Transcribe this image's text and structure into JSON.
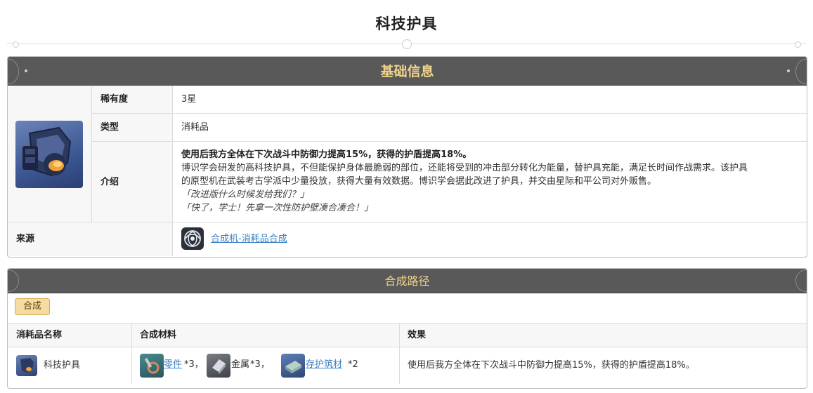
{
  "page": {
    "title": "科技护具"
  },
  "basic_info": {
    "header": "基础信息",
    "rows": {
      "rarity": {
        "label": "稀有度",
        "value": "3星"
      },
      "type": {
        "label": "类型",
        "value": "消耗品"
      },
      "intro": {
        "label": "介绍",
        "bold_line": "使用后我方全体在下次战斗中防御力提高15%，获得的护盾提高18%。",
        "body_1": "博识学会研发的高科技护具，不但能保护身体最脆弱的部位，还能将受到的冲击部分转化为能量，替护具充能，满足长时间作战需求。该护具",
        "body_2": "的原型机在武装考古学派中少量投放，获得大量有效数据。博识学会据此改进了护具，并交由星际和平公司对外贩售。",
        "quote_1": "「改进版什么时候发给我们？」",
        "quote_2": "「快了，学士！先拿一次性防护壁凑合凑合！」"
      },
      "source": {
        "label": "来源",
        "link": "合成机-消耗品合成"
      }
    }
  },
  "recipe": {
    "header": "合成路径",
    "tab": "合成",
    "columns": [
      "消耗品名称",
      "合成材料",
      "效果"
    ],
    "row": {
      "name": "科技护具",
      "materials": [
        {
          "name": "零件",
          "count": "*3，",
          "linked": true,
          "icon": "parts-icon"
        },
        {
          "name": "金属",
          "count": "*3，",
          "linked": false,
          "icon": "metal-icon"
        },
        {
          "name": "存护筑材",
          "count": "*2",
          "linked": true,
          "icon": "preservation-material-icon"
        }
      ],
      "effect": "使用后我方全体在下次战斗中防御力提高15%，获得的护盾提高18%。"
    }
  },
  "colors": {
    "header_bg": "#595959",
    "header_text": "#f1d48a",
    "link": "#3a7fc1",
    "tab_bg": "#f6dca0"
  }
}
